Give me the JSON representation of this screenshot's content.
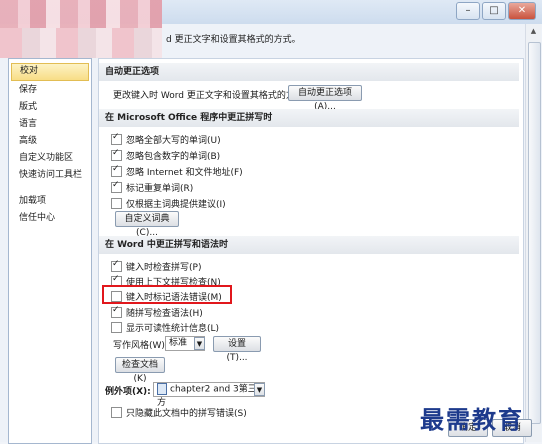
{
  "window": {
    "header_text": "d 更正文字和设置其格式的方式。",
    "buttons": {
      "minimize": "–",
      "maximize": "□",
      "close": "✕"
    }
  },
  "sidebar": {
    "items": [
      {
        "label": "校对",
        "selected": true
      },
      {
        "label": "保存"
      },
      {
        "label": "版式"
      },
      {
        "label": "语言"
      },
      {
        "label": "高级"
      },
      {
        "label": "自定义功能区"
      },
      {
        "label": "快速访问工具栏"
      },
      {
        "label": "加载项"
      },
      {
        "label": "信任中心"
      }
    ]
  },
  "autocorrect": {
    "section_title": "自动更正选项",
    "description": "更改键入时 Word 更正文字和设置其格式的方式:",
    "button_label": "自动更正选项(A)..."
  },
  "office_spelling": {
    "section_title": "在 Microsoft Office 程序中更正拼写时",
    "options": [
      {
        "label": "忽略全部大写的单词(U)",
        "checked": true
      },
      {
        "label": "忽略包含数字的单词(B)",
        "checked": true
      },
      {
        "label": "忽略 Internet 和文件地址(F)",
        "checked": true
      },
      {
        "label": "标记重复单词(R)",
        "checked": true
      },
      {
        "label": "仅根据主词典提供建议(I)",
        "checked": false
      }
    ],
    "custom_dict_button": "自定义词典(C)..."
  },
  "word_spelling": {
    "section_title": "在 Word 中更正拼写和语法时",
    "options": [
      {
        "label": "键入时检查拼写(P)",
        "checked": true
      },
      {
        "label": "使用上下文拼写检查(N)",
        "checked": true
      },
      {
        "label": "键入时标记语法错误(M)",
        "checked": false
      },
      {
        "label": "随拼写检查语法(H)",
        "checked": true
      },
      {
        "label": "显示可读性统计信息(L)",
        "checked": false
      }
    ],
    "writing_style_label": "写作风格(W):",
    "writing_style_value": "标准",
    "settings_button": "设置(T)...",
    "recheck_button": "检查文档(K)"
  },
  "exceptions": {
    "label": "例外项(X):",
    "value": "chapter2 and 3第三方",
    "hide_option": "只隐藏此文档中的拼写错误(S)"
  },
  "footer": {
    "ok": "确定",
    "cancel": "取消"
  },
  "watermark": "最需教育"
}
